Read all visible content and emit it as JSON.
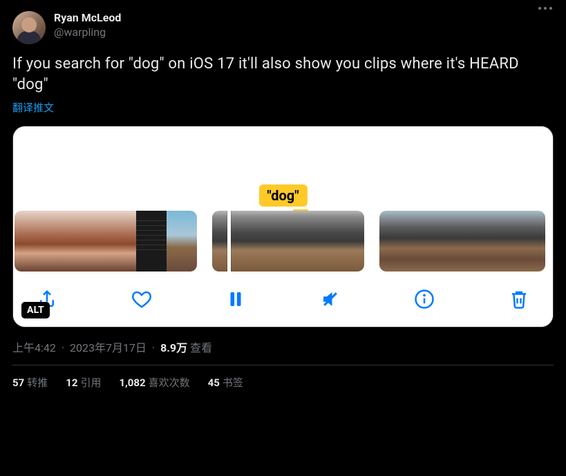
{
  "author": {
    "display_name": "Ryan McLeod",
    "handle": "@warpling"
  },
  "body_text": "If you search for \"dog\" on iOS 17 it'll also show you clips where it's HEARD \"dog\"",
  "translate_label": "翻译推文",
  "media": {
    "tag_text": "\"dog\"",
    "alt_badge": "ALT",
    "toolbar_icons": {
      "share": "share-icon",
      "like": "heart-icon",
      "pause": "pause-icon",
      "mute": "speaker-slash-icon",
      "info": "info-icon",
      "delete": "trash-icon"
    }
  },
  "meta": {
    "time": "上午4:42",
    "date": "2023年7月17日",
    "views_count": "8.9万",
    "views_label": "查看"
  },
  "stats": {
    "retweets": {
      "num": "57",
      "label": "转推"
    },
    "quotes": {
      "num": "12",
      "label": "引用"
    },
    "likes": {
      "num": "1,082",
      "label": "喜欢次数"
    },
    "bookmarks": {
      "num": "45",
      "label": "书签"
    }
  }
}
